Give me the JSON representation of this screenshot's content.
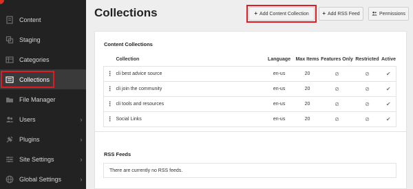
{
  "sidebar": {
    "items": [
      {
        "label": "Content",
        "icon": "content-icon",
        "chevron": false,
        "active": false
      },
      {
        "label": "Staging",
        "icon": "staging-icon",
        "chevron": false,
        "active": false
      },
      {
        "label": "Categories",
        "icon": "categories-icon",
        "chevron": false,
        "active": false
      },
      {
        "label": "Collections",
        "icon": "collections-icon",
        "chevron": false,
        "active": true
      },
      {
        "label": "File Manager",
        "icon": "folder-icon",
        "chevron": false,
        "active": false
      },
      {
        "label": "Users",
        "icon": "users-icon",
        "chevron": true,
        "active": false
      },
      {
        "label": "Plugins",
        "icon": "plugins-icon",
        "chevron": true,
        "active": false
      },
      {
        "label": "Site Settings",
        "icon": "settings-icon",
        "chevron": true,
        "active": false
      },
      {
        "label": "Global Settings",
        "icon": "globe-icon",
        "chevron": true,
        "active": false
      }
    ]
  },
  "header": {
    "title": "Collections",
    "buttons": {
      "add_collection": "Add Content Collection",
      "add_rss": "Add RSS Feed",
      "permissions": "Permissions"
    }
  },
  "collections": {
    "title": "Content Collections",
    "columns": {
      "collection": "Collection",
      "language": "Language",
      "max_items": "Max Items",
      "features_only": "Features Only",
      "restricted": "Restricted",
      "active": "Active"
    },
    "rows": [
      {
        "name": "cli best advice source",
        "language": "en-us",
        "max_items": "20"
      },
      {
        "name": "cli join the community",
        "language": "en-us",
        "max_items": "20"
      },
      {
        "name": "cli tools and resources",
        "language": "en-us",
        "max_items": "20"
      },
      {
        "name": "Social Links",
        "language": "en-us",
        "max_items": "20"
      }
    ]
  },
  "rss": {
    "title": "RSS Feeds",
    "empty_message": "There are currently no RSS feeds."
  },
  "colors": {
    "sidebar_bg": "#222222",
    "highlight": "#e01b24"
  }
}
